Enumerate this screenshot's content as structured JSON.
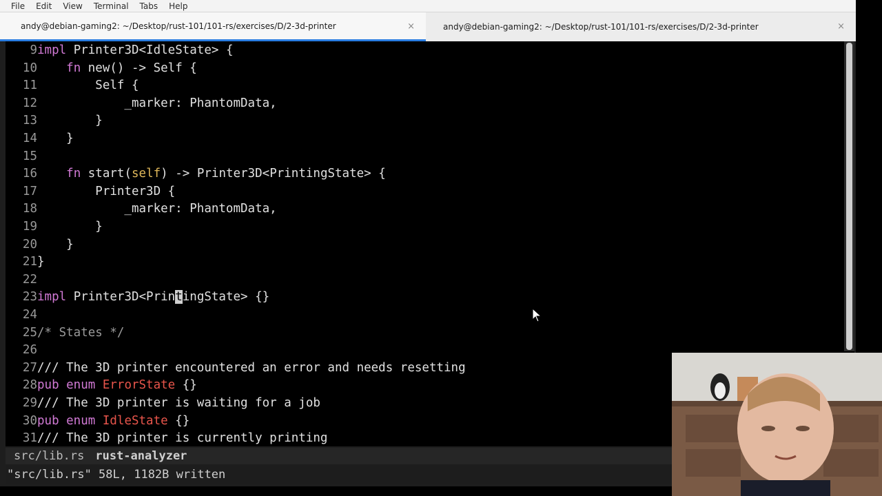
{
  "menu": [
    "File",
    "Edit",
    "View",
    "Terminal",
    "Tabs",
    "Help"
  ],
  "tabs": [
    {
      "title": "andy@debian-gaming2: ~/Desktop/rust-101/101-rs/exercises/D/2-3d-printer",
      "active": true
    },
    {
      "title": "andy@debian-gaming2: ~/Desktop/rust-101/101-rs/exercises/D/2-3d-printer",
      "active": false
    }
  ],
  "tab_close_glyph": "×",
  "lines": [
    {
      "n": "9",
      "tokens": [
        [
          "kw",
          "impl"
        ],
        [
          "ty",
          " Printer3D<IdleState> {"
        ]
      ]
    },
    {
      "n": "10",
      "tokens": [
        [
          "ty",
          "    "
        ],
        [
          "kw",
          "fn"
        ],
        [
          "ty",
          " new() -> Self {"
        ]
      ]
    },
    {
      "n": "11",
      "tokens": [
        [
          "ty",
          "        Self {"
        ]
      ]
    },
    {
      "n": "12",
      "tokens": [
        [
          "ty",
          "            _marker: PhantomData,"
        ]
      ]
    },
    {
      "n": "13",
      "tokens": [
        [
          "ty",
          "        }"
        ]
      ]
    },
    {
      "n": "14",
      "tokens": [
        [
          "ty",
          "    }"
        ]
      ]
    },
    {
      "n": "15",
      "tokens": []
    },
    {
      "n": "16",
      "tokens": [
        [
          "ty",
          "    "
        ],
        [
          "kw",
          "fn"
        ],
        [
          "ty",
          " start("
        ],
        [
          "self",
          "self"
        ],
        [
          "ty",
          ") -> Printer3D<PrintingState> {"
        ]
      ]
    },
    {
      "n": "17",
      "tokens": [
        [
          "ty",
          "        Printer3D {"
        ]
      ]
    },
    {
      "n": "18",
      "tokens": [
        [
          "ty",
          "            _marker: PhantomData,"
        ]
      ]
    },
    {
      "n": "19",
      "tokens": [
        [
          "ty",
          "        }"
        ]
      ]
    },
    {
      "n": "20",
      "tokens": [
        [
          "ty",
          "    }"
        ]
      ]
    },
    {
      "n": "21",
      "tokens": [
        [
          "ty",
          "}"
        ]
      ]
    },
    {
      "n": "22",
      "tokens": []
    },
    {
      "n": "23",
      "tokens": [
        [
          "kw",
          "impl"
        ],
        [
          "ty",
          " Printer3D<Prin"
        ],
        [
          "cursor",
          "t"
        ],
        [
          "ty",
          "ingState> {}"
        ]
      ]
    },
    {
      "n": "24",
      "tokens": []
    },
    {
      "n": "25",
      "tokens": [
        [
          "comment",
          "/* States */"
        ]
      ]
    },
    {
      "n": "26",
      "tokens": []
    },
    {
      "n": "27",
      "tokens": [
        [
          "doc",
          "/// The 3D printer encountered an error and needs resetting"
        ]
      ]
    },
    {
      "n": "28",
      "tokens": [
        [
          "kw",
          "pub enum"
        ],
        [
          "ty",
          " "
        ],
        [
          "red",
          "ErrorState"
        ],
        [
          "ty",
          " {}"
        ]
      ]
    },
    {
      "n": "29",
      "tokens": [
        [
          "doc",
          "/// The 3D printer is waiting for a job"
        ]
      ]
    },
    {
      "n": "30",
      "tokens": [
        [
          "kw",
          "pub enum"
        ],
        [
          "ty",
          " "
        ],
        [
          "red",
          "IdleState"
        ],
        [
          "ty",
          " {}"
        ]
      ]
    },
    {
      "n": "31",
      "tokens": [
        [
          "doc",
          "/// The 3D printer is currently printing"
        ]
      ]
    }
  ],
  "statusline": {
    "file": "src/lib.rs",
    "lsp": "rust-analyzer"
  },
  "cmdline": "\"src/lib.rs\" 58L, 1182B written",
  "colors": {
    "keyword": "#d27ad6",
    "self": "#e0b85a",
    "type_red": "#e8554b",
    "active_tab_underline": "#2a7de1"
  }
}
